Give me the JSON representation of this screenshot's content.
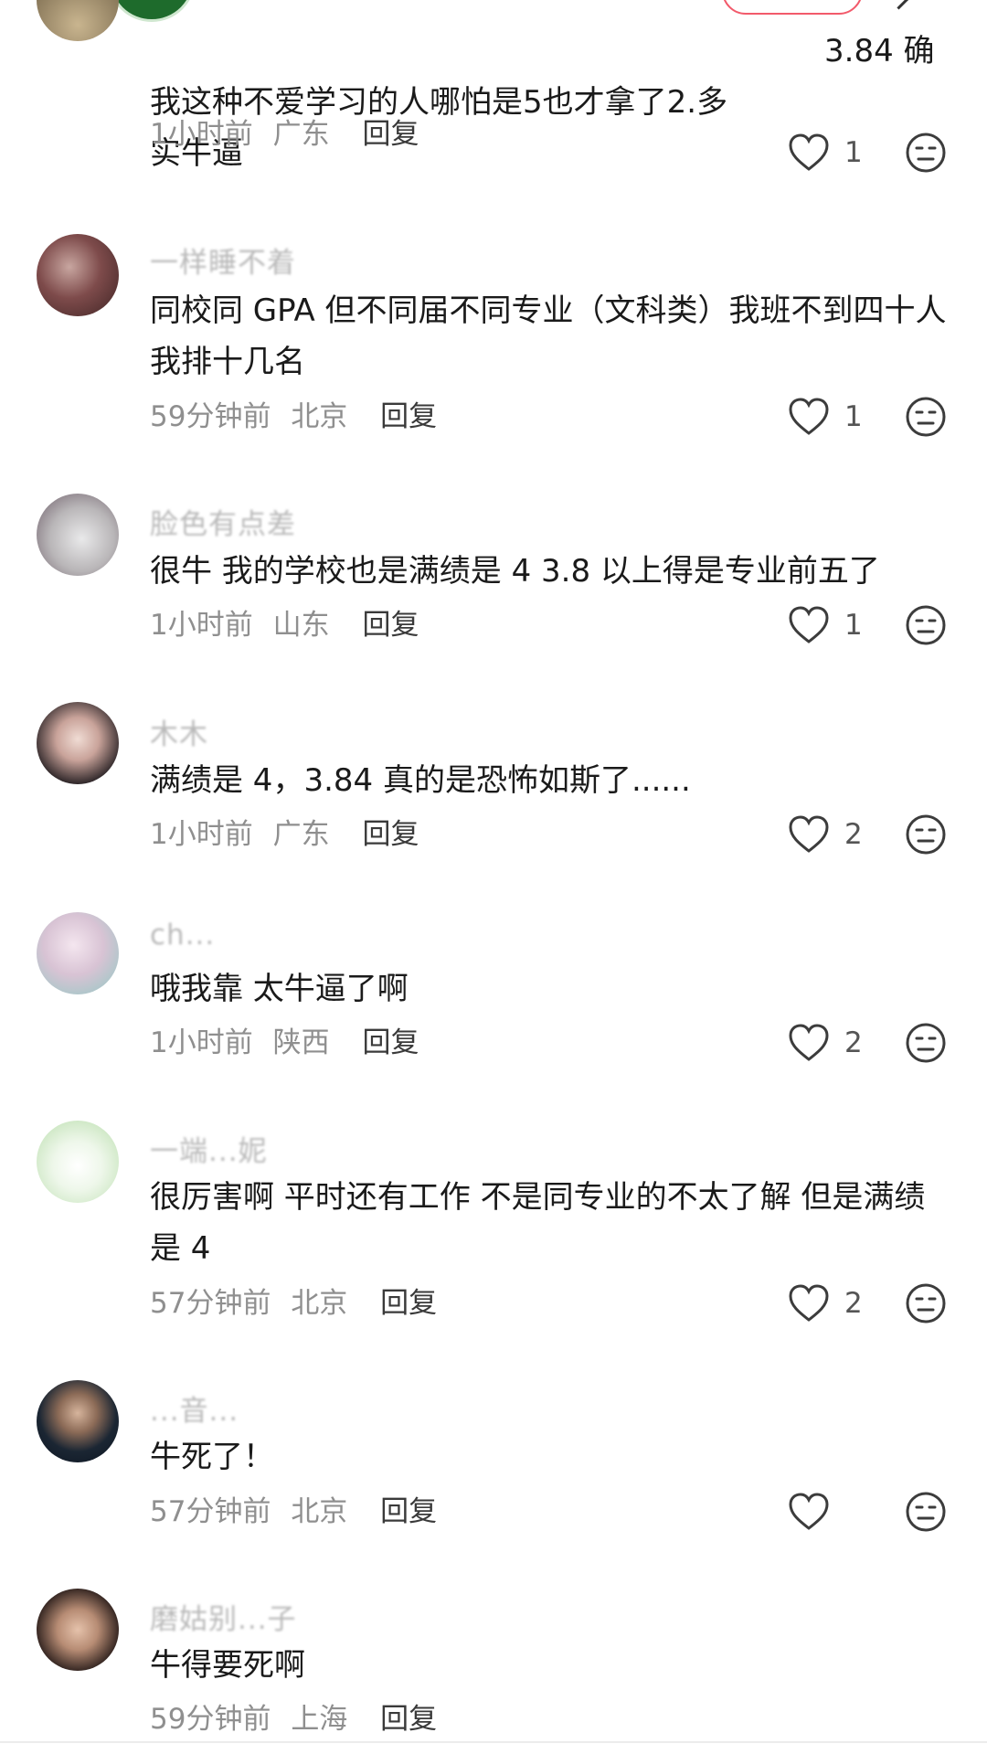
{
  "comments": [
    {
      "username": "",
      "text": "我这种不爱学习的人哪怕是5也才拿了2.多\n实牛逼",
      "text_tail": "3.84 确",
      "time": "1小时前",
      "location": "广东",
      "reply": "回复",
      "likes": "1"
    },
    {
      "username": "一样睡不着",
      "text": "同校同 GPA 但不同届不同专业（文科类）我班不到四十人\n我排十几名",
      "time": "59分钟前",
      "location": "北京",
      "reply": "回复",
      "likes": "1"
    },
    {
      "username": "脸色有点差",
      "text": "很牛 我的学校也是满绩是 4 3.8 以上得是专业前五了",
      "time": "1小时前",
      "location": "山东",
      "reply": "回复",
      "likes": "1"
    },
    {
      "username": "木木",
      "text": "满绩是 4，3.84 真的是恐怖如斯了......",
      "time": "1小时前",
      "location": "广东",
      "reply": "回复",
      "likes": "2"
    },
    {
      "username": "ch...",
      "text": "哦我靠 太牛逼了啊",
      "time": "1小时前",
      "location": "陕西",
      "reply": "回复",
      "likes": "2"
    },
    {
      "username": "一端...妮",
      "text": "很厉害啊 平时还有工作 不是同专业的不太了解 但是满绩\n是 4",
      "time": "57分钟前",
      "location": "北京",
      "reply": "回复",
      "likes": "2"
    },
    {
      "username": "...音...",
      "text": "牛死了！",
      "time": "57分钟前",
      "location": "北京",
      "reply": "回复",
      "likes": ""
    },
    {
      "username": "磨姑别...子",
      "text": "牛得要死啊",
      "time": "59分钟前",
      "location": "上海",
      "reply": "回复",
      "likes": ""
    }
  ],
  "icons": {
    "like": "heart-outline-icon",
    "dislike": "neutral-face-icon"
  },
  "colors": {
    "meta_gray": "#8f8f8f",
    "text_dark": "#1a1a1a",
    "username_gray": "#b9b9b9"
  }
}
